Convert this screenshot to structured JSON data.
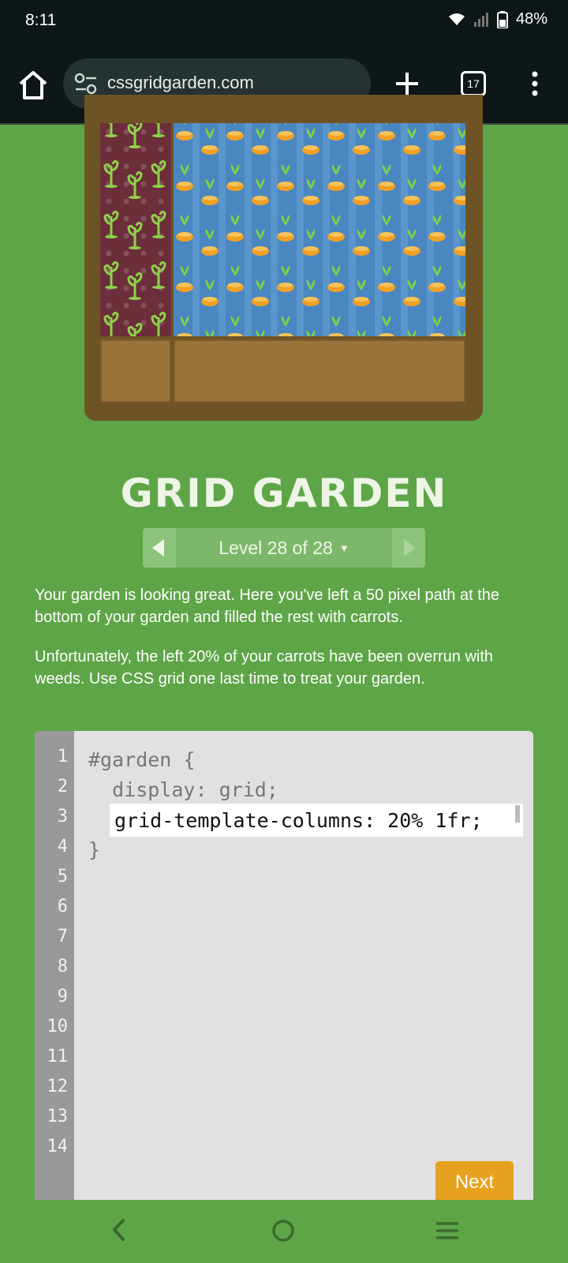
{
  "status_bar": {
    "time": "8:11",
    "battery": "48%"
  },
  "browser": {
    "url": "cssgridgarden.com",
    "tab_count": "17"
  },
  "game": {
    "title": "GRID GARDEN",
    "level_label": "Level 28 of 28",
    "instructions": [
      "Your garden is looking great. Here you've left a 50 pixel path at the bottom of your garden and filled the rest with carrots.",
      "Unfortunately, the left 20% of your carrots have been overrun with weeds. Use CSS grid one last time to treat your garden."
    ],
    "line_numbers": [
      "1",
      "2",
      "3",
      "4",
      "5",
      "6",
      "7",
      "8",
      "9",
      "10",
      "11",
      "12",
      "13",
      "14"
    ],
    "code": {
      "line1": "#garden {",
      "line2": "  display: grid;",
      "input_value": "grid-template-columns: 20% 1fr;",
      "line4": "}"
    },
    "next_label": "Next"
  },
  "colors": {
    "background": "#5ea547",
    "board": "#6e5424",
    "weeds": "#6b2e3a",
    "water": "#4a86bf",
    "carrot": "#f2a125",
    "leaf": "#7fd14a",
    "next_button": "#e6a11f"
  }
}
